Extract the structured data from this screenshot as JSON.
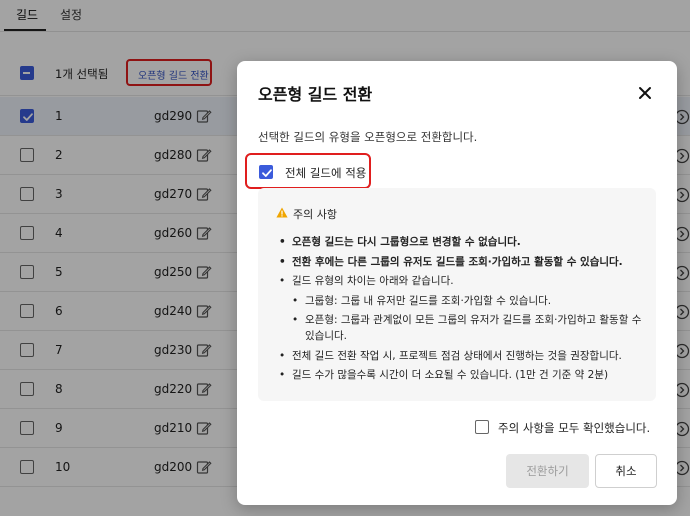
{
  "tabs": [
    {
      "label": "길드"
    },
    {
      "label": "설정"
    }
  ],
  "list": {
    "selected_count": "1개 선택됨",
    "convert_link": "오픈형 길드 전환",
    "rows": [
      {
        "num": "1",
        "name": "gd290",
        "checked": true
      },
      {
        "num": "2",
        "name": "gd280",
        "checked": false
      },
      {
        "num": "3",
        "name": "gd270",
        "checked": false
      },
      {
        "num": "4",
        "name": "gd260",
        "checked": false
      },
      {
        "num": "5",
        "name": "gd250",
        "checked": false
      },
      {
        "num": "6",
        "name": "gd240",
        "checked": false
      },
      {
        "num": "7",
        "name": "gd230",
        "checked": false
      },
      {
        "num": "8",
        "name": "gd220",
        "checked": false
      },
      {
        "num": "9",
        "name": "gd210",
        "checked": false
      },
      {
        "num": "10",
        "name": "gd200",
        "checked": false
      }
    ]
  },
  "modal": {
    "title": "오픈형 길드 전환",
    "description": "선택한 길드의 유형을 오픈형으로 전환합니다.",
    "apply_all_label": "전체 길드에 적용",
    "apply_all_checked": true,
    "notice_title": "주의 사항",
    "notice_items": [
      "오픈형 길드는 다시 그룹형으로 변경할 수 없습니다.",
      "전환 후에는 다른 그룹의 유저도 길드를 조회·가입하고 활동할 수 있습니다.",
      "길드 유형의 차이는 아래와 같습니다.",
      "그룹형: 그룹 내 유저만 길드를 조회·가입할 수 있습니다.",
      "오픈형: 그룹과 관계없이 모든 그룹의 유저가 길드를 조회·가입하고 활동할 수 있습니다.",
      "전체 길드 전환 작업 시, 프로젝트 점검 상태에서 진행하는 것을 권장합니다.",
      "길드 수가 많을수록 시간이 더 소요될 수 있습니다. (1만 건 기준 약 2분)"
    ],
    "confirm_label": "주의 사항을 모두 확인했습니다.",
    "confirm_checked": false,
    "convert_button": "전환하기",
    "cancel_button": "취소"
  },
  "colors": {
    "accent": "#3b5bdb",
    "highlight_border": "#e01e1e",
    "warning": "#f0a500"
  },
  "icons": {
    "edit": "edit-icon",
    "close": "close-icon",
    "warning": "warning-icon",
    "row_action": "circle-arrow-icon"
  }
}
